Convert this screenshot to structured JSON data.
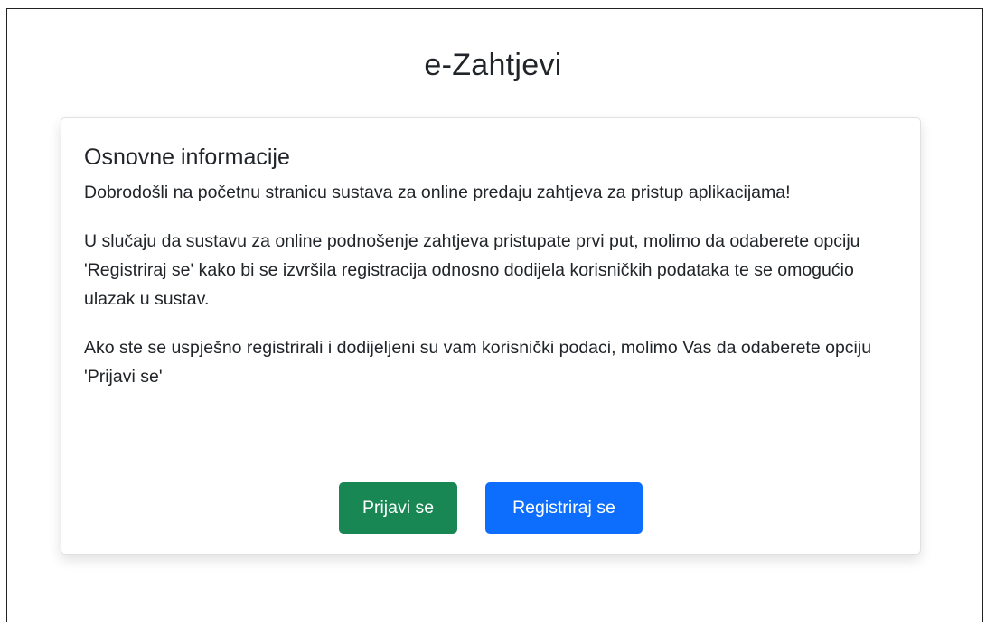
{
  "header": {
    "app_title": "e-Zahtjevi"
  },
  "card": {
    "title": "Osnovne informacije",
    "paragraphs": [
      "Dobrodošli na početnu stranicu sustava za online predaju zahtjeva za pristup aplikacijama!",
      "U slučaju da sustavu za online podnošenje zahtjeva pristupate prvi put, molimo da odaberete opciju 'Registriraj se' kako bi se izvršila registracija odnosno dodijela korisničkih podataka te se omogućio ulazak u sustav.",
      "Ako ste se uspješno registrirali i dodijeljeni su vam korisnički podaci, molimo Vas da odaberete opciju 'Prijavi se'"
    ]
  },
  "actions": {
    "login_label": "Prijavi se",
    "register_label": "Registriraj se"
  },
  "colors": {
    "login_button": "#198754",
    "register_button": "#0d6efd",
    "text": "#212529"
  }
}
